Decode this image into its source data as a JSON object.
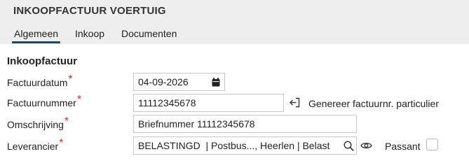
{
  "header": {
    "title": "INKOOPFACTUUR VOERTUIG",
    "tabs": [
      {
        "label": "Algemeen",
        "active": true
      },
      {
        "label": "Inkoop",
        "active": false
      },
      {
        "label": "Documenten",
        "active": false
      }
    ]
  },
  "section": {
    "title": "Inkoopfactuur"
  },
  "form": {
    "factuurdatum": {
      "label": "Factuurdatum",
      "required_mark": "*",
      "value": "04-09-2026",
      "icon": "calendar-icon"
    },
    "factuurnummer": {
      "label": "Factuurnummer",
      "required_mark": "*",
      "value": "11112345678",
      "action_icon": "login-arrow-icon",
      "action_label": "Genereer factuurnr. particulier"
    },
    "omschrijving": {
      "label": "Omschrijving",
      "required_mark": "*",
      "value": "Briefnummer 11112345678"
    },
    "leverancier": {
      "label": "Leverancier",
      "required_mark": "*",
      "value": "BELASTINGD  | Postbus..., Heerlen | Belast",
      "search_icon": "search-icon",
      "view_icon": "eye-icon"
    },
    "passant": {
      "label": "Passant",
      "checked": false
    }
  },
  "colors": {
    "tab_underline": "#1d4a5a",
    "required": "#d32f2f",
    "header_bg": "#eeeeee"
  }
}
